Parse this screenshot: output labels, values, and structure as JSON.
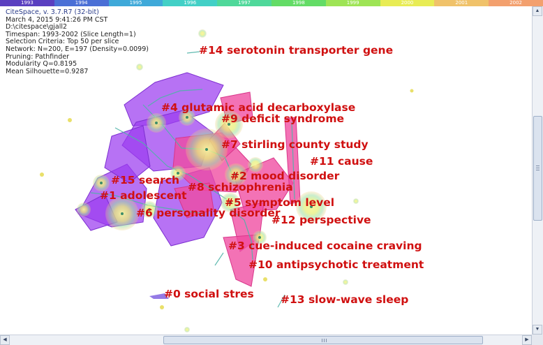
{
  "timeline": {
    "years": [
      "1993",
      "1994",
      "1995",
      "1996",
      "1997",
      "1998",
      "1999",
      "2000",
      "2001",
      "2002"
    ],
    "colors": [
      "#5a3fc0",
      "#4a6fd6",
      "#3fa9d9",
      "#42d0c6",
      "#4fd89a",
      "#63dc66",
      "#9ee455",
      "#e8ec54",
      "#f0c26a",
      "#f3a06e"
    ]
  },
  "info": {
    "app": "CiteSpace, v. 3.7.R7 (32-bit)",
    "date": "March 4, 2015 9:41:26 PM CST",
    "path": "D:\\citespace\\gjall2",
    "timespan": "Timespan: 1993-2002 (Slice Length=1)",
    "selection": "Selection Criteria: Top 50 per slice",
    "network": "Network: N=200, E=197 (Density=0.0099)",
    "pruning": "Pruning: Pathfinder",
    "modularity": "Modularity Q=0.8195",
    "silhouette": "Mean Silhouette=0.9287"
  },
  "clusters": [
    {
      "label": "#14 serotonin transporter gene"
    },
    {
      "label": "#4 glutamic acid decarboxylase"
    },
    {
      "label": "#9 deficit syndrome"
    },
    {
      "label": "#7 stirling county study"
    },
    {
      "label": "#11 cause"
    },
    {
      "label": "#2 mood disorder"
    },
    {
      "label": "#15 search"
    },
    {
      "label": "#8 schizophrenia"
    },
    {
      "label": "#1 adolescent"
    },
    {
      "label": "#5 symptom level"
    },
    {
      "label": "#6 personality disorder"
    },
    {
      "label": "#12 perspective"
    },
    {
      "label": "#3 cue-induced cocaine craving"
    },
    {
      "label": "#10 antipsychotic treatment"
    },
    {
      "label": "#0 social stres"
    },
    {
      "label": "#13 slow-wave sleep"
    }
  ],
  "colors": {
    "label": "#d01010",
    "purple": "#9b3cf0",
    "magenta": "#f04aa0",
    "node": "#f3ec7a"
  }
}
